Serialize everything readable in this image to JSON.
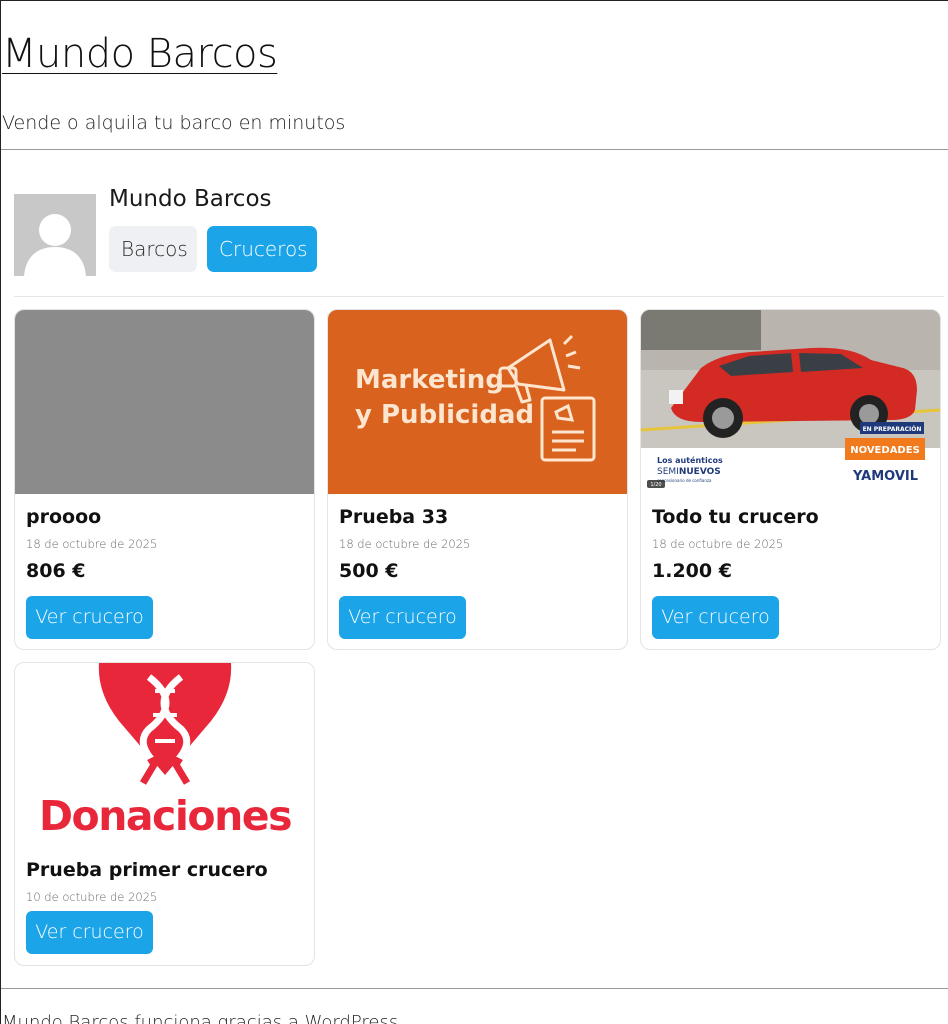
{
  "site": {
    "title": "Mundo Barcos",
    "tagline": "Vende o alquila tu barco en minutos"
  },
  "profile": {
    "name": "Mundo Barcos",
    "filters": [
      "Barcos",
      "Cruceros"
    ],
    "active_filter": "Cruceros"
  },
  "cards": [
    {
      "title": "proooo",
      "date": "18 de octubre de 2025",
      "price": "806 €",
      "button": "Ver crucero",
      "image": "gray-placeholder"
    },
    {
      "title": "Prueba 33",
      "date": "18 de octubre de 2025",
      "price": "500 €",
      "button": "Ver crucero",
      "image": "marketing-banner",
      "image_text": [
        "Marketing",
        "y Publicidad"
      ]
    },
    {
      "title": "Todo tu crucero",
      "date": "18 de octubre de 2025",
      "price": "1.200 €",
      "button": "Ver crucero",
      "image": "red-car-ad",
      "image_text": [
        "EN PREPARACIÓN",
        "NOVEDADES",
        "Los auténticos",
        "SEMI",
        "NUEVOS",
        "concesionario de confianza",
        "YAMOVIL",
        "1/20"
      ]
    },
    {
      "title": "Prueba primer crucero",
      "date": "10 de octubre de 2025",
      "button": "Ver crucero",
      "image": "donaciones-heart",
      "image_text": [
        "Donaciones"
      ]
    }
  ],
  "footer": {
    "text": "Mundo Barcos funciona gracias a WordPress"
  },
  "colors": {
    "accent": "#1ba4e8",
    "marketing_bg": "#d9621e",
    "car_red": "#d42a24",
    "donaciones_red": "#e8283a"
  }
}
